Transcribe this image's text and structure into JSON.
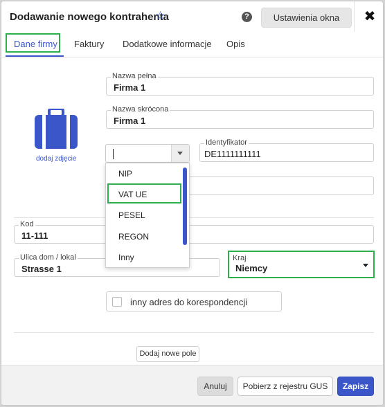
{
  "header": {
    "title": "Dodawanie nowego kontrahenta",
    "settings_label": "Ustawienia okna",
    "help_symbol": "?",
    "close_symbol": "✖",
    "star_symbol": "☆"
  },
  "tabs": [
    {
      "label": "Dane firmy",
      "active": true
    },
    {
      "label": "Faktury",
      "active": false
    },
    {
      "label": "Dodatkowe informacje",
      "active": false
    },
    {
      "label": "Opis",
      "active": false
    }
  ],
  "photo": {
    "link_label": "dodaj zdjęcie",
    "icon": "suitcase-icon"
  },
  "fields": {
    "full_name": {
      "label": "Nazwa pełna",
      "value": "Firma 1"
    },
    "short_name": {
      "label": "Nazwa skrócona",
      "value": "Firma 1"
    },
    "identifier": {
      "label": "Identyfikator",
      "value": "DE1111111111"
    },
    "postal_code": {
      "label": "Kod",
      "value": "11-111"
    },
    "street": {
      "label": "Ulica dom / lokal",
      "value": "Strasse 1"
    },
    "country": {
      "label": "Kraj",
      "value": "Niemcy"
    }
  },
  "id_type_dropdown": {
    "value": "",
    "options": [
      "NIP",
      "VAT UE",
      "PESEL",
      "REGON",
      "Inny"
    ],
    "highlighted": "VAT UE"
  },
  "correspondence": {
    "label": "inny adres do korespondencji",
    "checked": false
  },
  "add_field_label": "Dodaj nowe pole",
  "footer": {
    "cancel_label": "Anuluj",
    "gus_label": "Pobierz z rejestru GUS",
    "save_label": "Zapisz"
  },
  "colors": {
    "accent": "#3a56c8",
    "highlight": "#2fae4e"
  }
}
